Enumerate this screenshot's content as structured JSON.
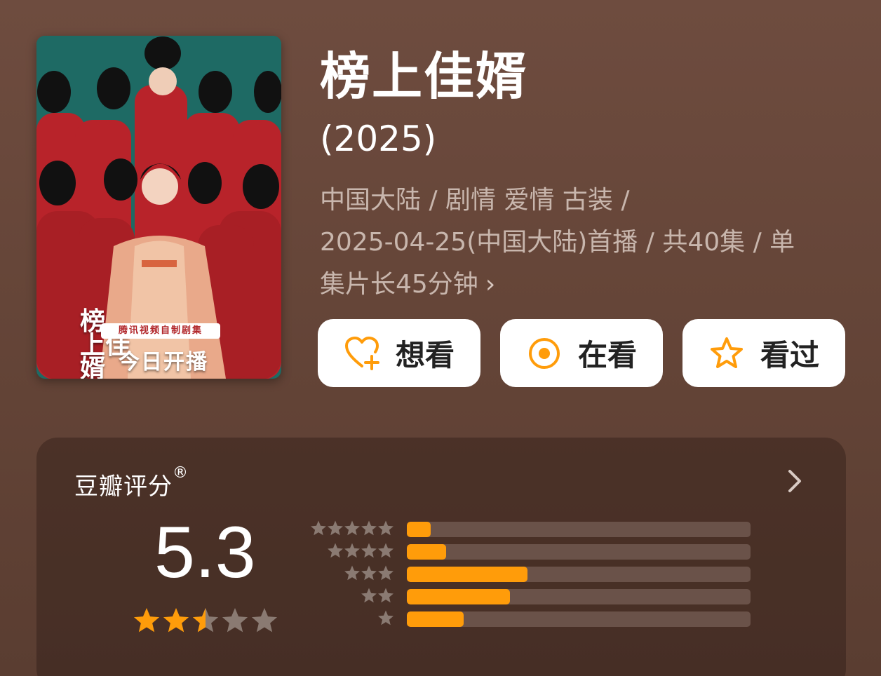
{
  "poster": {
    "title_lines": [
      "榜",
      "上佳",
      "婿"
    ],
    "banner": "腾讯视频自制剧集",
    "headline": "今日开播"
  },
  "title": "榜上佳婿",
  "year": "(2025)",
  "meta": {
    "line1": "中国大陆 / 剧情 爱情 古装 /",
    "line2": "2025-04-25(中国大陆)首播 / 共40集 / 单",
    "line3": "集片长45分钟",
    "more_icon": "chevron-right-icon"
  },
  "actions": [
    {
      "label": "想看",
      "icon": "heart-plus-icon"
    },
    {
      "label": "在看",
      "icon": "target-circle-icon"
    },
    {
      "label": "看过",
      "icon": "star-outline-icon"
    }
  ],
  "rating": {
    "label": "豆瓣评分",
    "reg_mark": "®",
    "score": "5.3",
    "stars_filled": 2.5,
    "stars_total": 5,
    "distribution": [
      {
        "stars": 5,
        "percent": 7
      },
      {
        "stars": 4,
        "percent": 11.5
      },
      {
        "stars": 3,
        "percent": 35
      },
      {
        "stars": 2,
        "percent": 30
      },
      {
        "stars": 1,
        "percent": 16.5
      }
    ]
  },
  "colors": {
    "accent": "#ff9c0a",
    "star_empty": "#8a7a72",
    "meta_text": "#c8b6ad"
  }
}
